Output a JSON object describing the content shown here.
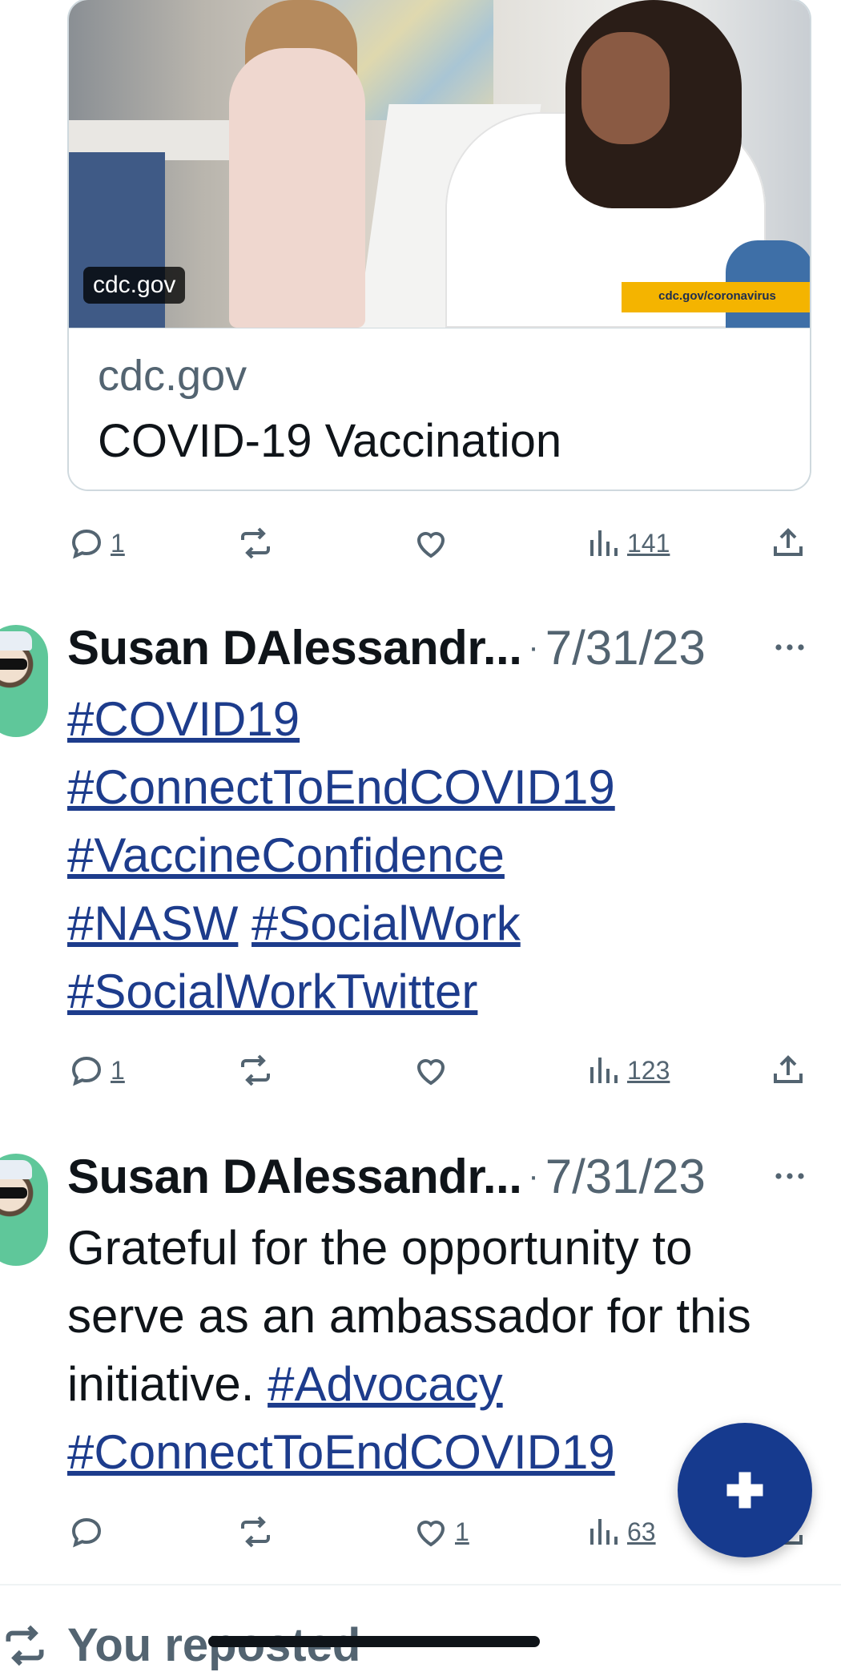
{
  "link_card": {
    "image_badge": "cdc.gov",
    "image_stripe_text": "cdc.gov/coronavirus",
    "domain": "cdc.gov",
    "title": "COVID-19 Vaccination"
  },
  "first_actions": {
    "replies": "1",
    "reposts": "",
    "likes": "",
    "views": "141"
  },
  "tweets": [
    {
      "author": "Susan DAlessandr...",
      "separator": "·",
      "date": "7/31/23",
      "hashtags": [
        "#COVID19",
        "#ConnectToEndCOVID19",
        "#VaccineConfidence",
        "#NASW",
        "#SocialWork",
        "#SocialWorkTwitter"
      ],
      "actions": {
        "replies": "1",
        "reposts": "",
        "likes": "",
        "views": "123"
      }
    },
    {
      "author": "Susan DAlessandr...",
      "separator": "·",
      "date": "7/31/23",
      "text": "Grateful for the opportunity to serve as an ambassador for this initiative.",
      "hashtags": [
        "#Advocacy",
        "#ConnectToEndCOVID19"
      ],
      "actions": {
        "replies": "",
        "reposts": "",
        "likes": "1",
        "views": "63"
      }
    }
  ],
  "social_context": {
    "label": "You reposted"
  },
  "icons": {
    "reply": "reply-icon",
    "repost": "repost-icon",
    "like": "heart-icon",
    "views": "views-icon",
    "share": "share-icon",
    "more": "more-icon",
    "compose": "plus-icon"
  },
  "colors": {
    "accent": "#163a8e",
    "link": "#1d3c8c",
    "muted": "#536471",
    "text": "#0f1419"
  }
}
